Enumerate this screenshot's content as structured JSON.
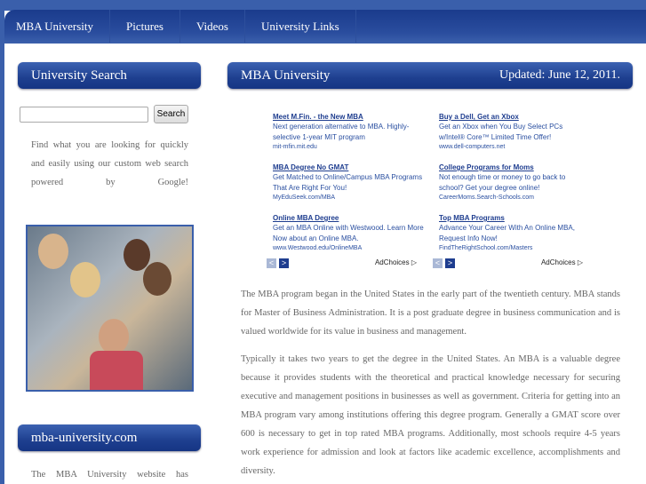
{
  "nav": [
    "MBA University",
    "Pictures",
    "Videos",
    "University Links"
  ],
  "sidebar": {
    "search_header": "University Search",
    "search_button": "Search",
    "search_value": "",
    "search_text": "Find what you are looking for quickly and easily using our custom web search powered by Google!",
    "site_header": "mba-university.com",
    "site_text": "The MBA University website has"
  },
  "main": {
    "header": "MBA University",
    "updated": "Updated: June 12, 2011.",
    "paragraphs": [
      "The MBA program began in the United States in the early part of the twentieth century. MBA stands for Master of Business Administration. It is a post graduate degree in business communication and is valued worldwide for its value in business and management.",
      "Typically it takes two years to get the degree in the United States. An MBA is a valuable degree because it provides students with the theoretical and practical knowledge necessary for securing executive and management positions in businesses as well as government. Criteria for getting into an MBA program vary among institutions offering this degree program. Generally a GMAT score over 600 is necessary to get in top rated MBA programs. Additionally, most schools require 4-5 years work experience for admission and look at factors like academic excellence, accomplishments and diversity."
    ]
  },
  "ads": [
    [
      {
        "title": "Meet M.Fin. - the New MBA",
        "desc": "Next generation alternative to MBA. Highly-selective 1-year MIT program",
        "url": "mit-mfin.mit.edu"
      },
      {
        "title": "MBA Degree No GMAT",
        "desc": "Get Matched to Online/Campus MBA Programs That Are Right For You!",
        "url": "MyEduSeek.com/MBA"
      },
      {
        "title": "Online MBA Degree",
        "desc": "Get an MBA Online with Westwood. Learn More Now about an Online MBA.",
        "url": "www.Westwood.edu/OnlineMBA"
      }
    ],
    [
      {
        "title": "Buy a Dell, Get an Xbox",
        "desc": "Get an Xbox when You Buy Select PCs w/Intel® Core™ Limited Time Offer!",
        "url": "www.dell-computers.net"
      },
      {
        "title": "College Programs for Moms",
        "desc": "Not enough time or money to go back to school? Get your degree online!",
        "url": "CareerMoms.Search-Schools.com"
      },
      {
        "title": "Top MBA Programs",
        "desc": "Advance Your Career With An Online MBA, Request Info Now!",
        "url": "FindTheRightSchool.com/Masters"
      }
    ]
  ],
  "adchoices": "AdChoices ▷",
  "colors": {
    "brand": "#1e3f8f",
    "strip": "#3a5fab"
  }
}
